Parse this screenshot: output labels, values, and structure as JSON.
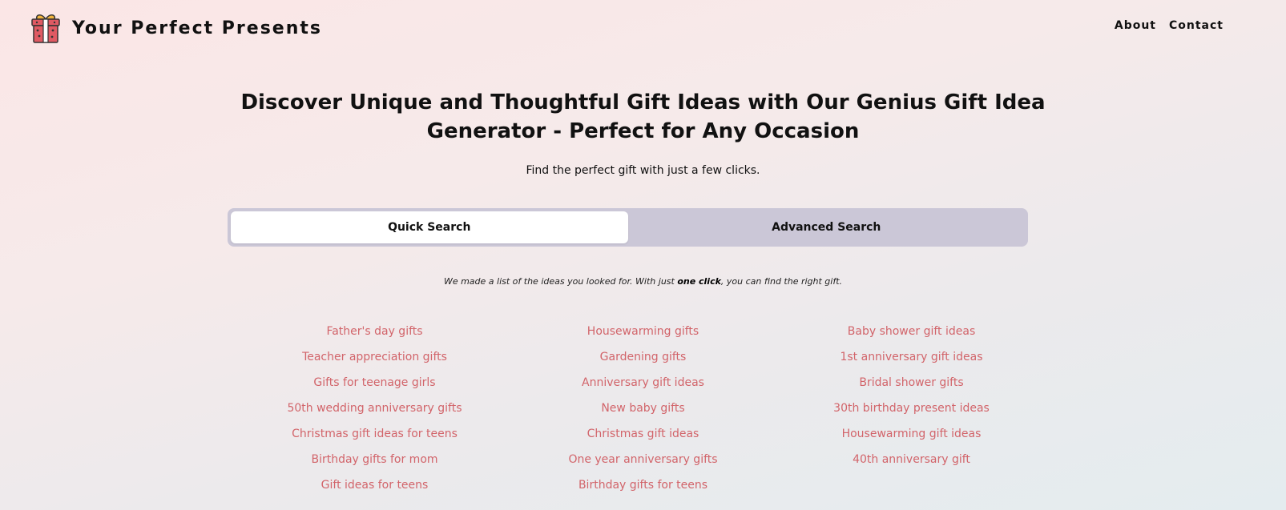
{
  "header": {
    "brand": "Your Perfect Presents",
    "logo_icon": "gift-icon",
    "nav": [
      {
        "label": "About"
      },
      {
        "label": "Contact"
      }
    ]
  },
  "hero": {
    "title": "Discover Unique and Thoughtful Gift Ideas with Our Genius Gift Idea Generator - Perfect for Any Occasion",
    "subtitle": "Find the perfect gift with just a few clicks."
  },
  "tabs": [
    {
      "label": "Quick Search",
      "active": true
    },
    {
      "label": "Advanced Search",
      "active": false
    }
  ],
  "note": {
    "before": "We made a list of the ideas you looked for. With just ",
    "bold": "one click",
    "after": ", you can find the right gift."
  },
  "ideas": {
    "col1": [
      "Father's day gifts",
      "Teacher appreciation gifts",
      "Gifts for teenage girls",
      "50th wedding anniversary gifts",
      "Christmas gift ideas for teens",
      "Birthday gifts for mom",
      "Gift ideas for teens"
    ],
    "col2": [
      "Housewarming gifts",
      "Gardening gifts",
      "Anniversary gift ideas",
      "New baby gifts",
      "Christmas gift ideas",
      "One year anniversary gifts",
      "Birthday gifts for teens"
    ],
    "col3": [
      "Baby shower gift ideas",
      "1st anniversary gift ideas",
      "Bridal shower gifts",
      "30th birthday present ideas",
      "Housewarming gift ideas",
      "40th anniversary gift"
    ]
  },
  "colors": {
    "link": "#d2646a",
    "tab_bar": "#cbc7d7",
    "gift_box": "#e05a63",
    "gift_bow": "#f2b43c"
  }
}
